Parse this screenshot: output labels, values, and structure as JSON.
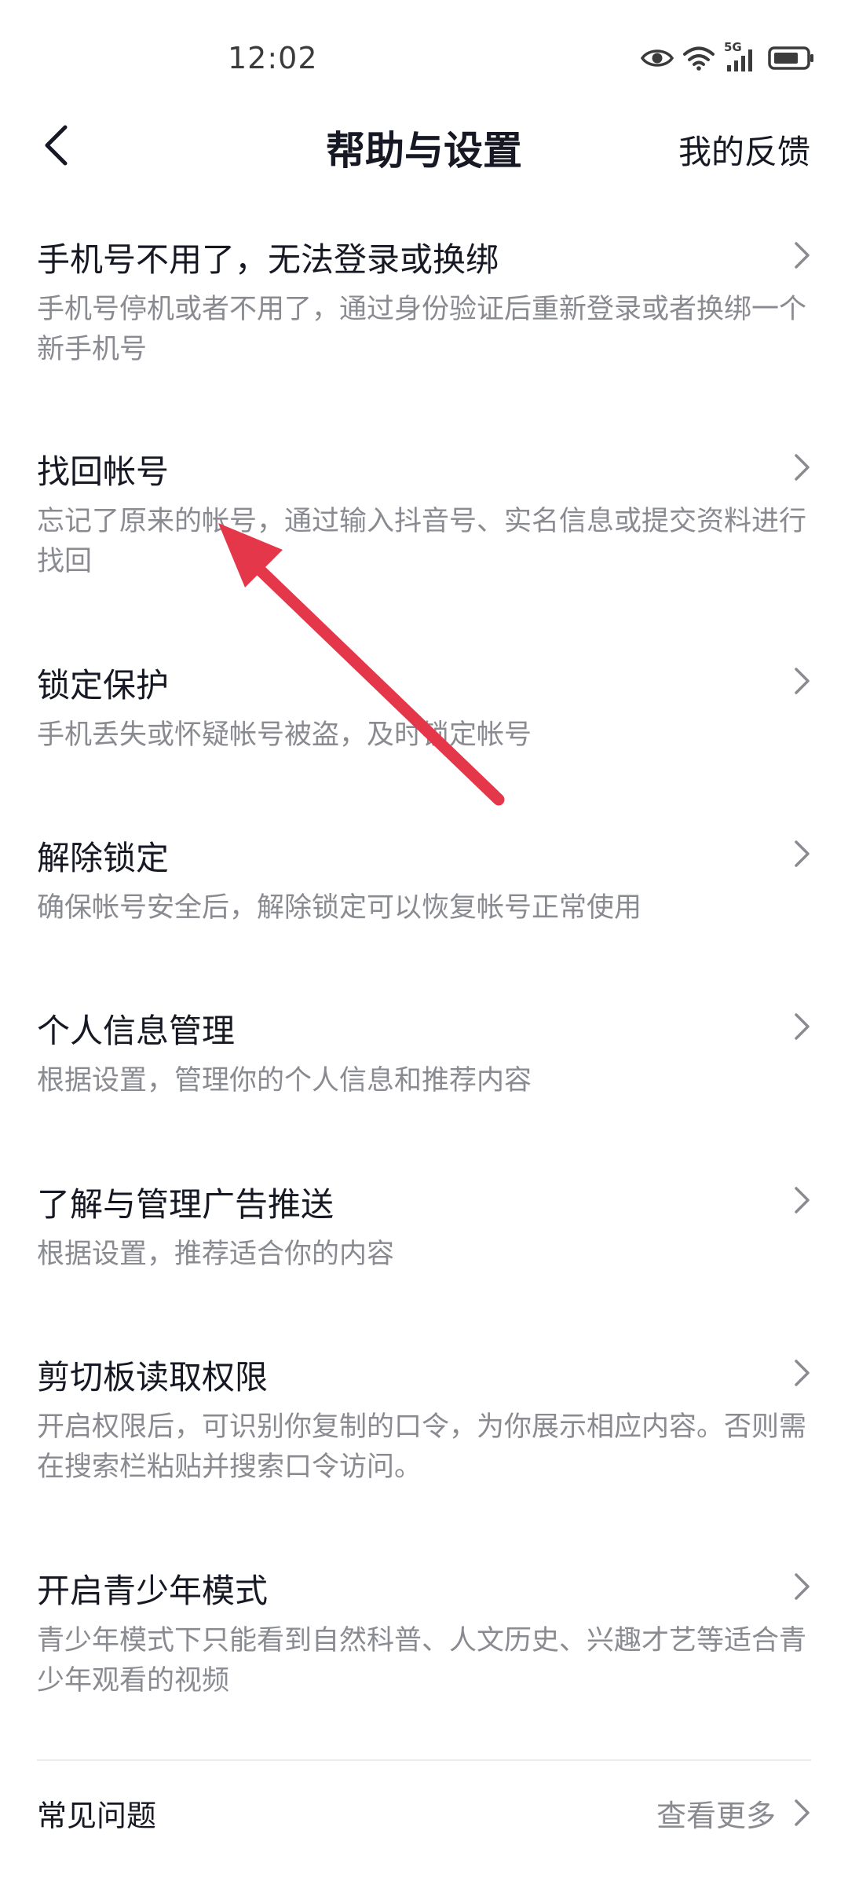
{
  "status_bar": {
    "time": "12:02",
    "network_label": "5G"
  },
  "header": {
    "title": "帮助与设置",
    "feedback_label": "我的反馈"
  },
  "items": [
    {
      "title": "手机号不用了，无法登录或换绑",
      "desc": "手机号停机或者不用了，通过身份验证后重新登录或者换绑一个新手机号"
    },
    {
      "title": "找回帐号",
      "desc": "忘记了原来的帐号，通过输入抖音号、实名信息或提交资料进行找回"
    },
    {
      "title": "锁定保护",
      "desc": "手机丢失或怀疑帐号被盗，及时锁定帐号"
    },
    {
      "title": "解除锁定",
      "desc": "确保帐号安全后，解除锁定可以恢复帐号正常使用"
    },
    {
      "title": "个人信息管理",
      "desc": "根据设置，管理你的个人信息和推荐内容"
    },
    {
      "title": "了解与管理广告推送",
      "desc": "根据设置，推荐适合你的内容"
    },
    {
      "title": "剪切板读取权限",
      "desc": "开启权限后，可识别你复制的口令，为你展示相应内容。否则需在搜索栏粘贴并搜索口令访问。"
    },
    {
      "title": "开启青少年模式",
      "desc": "青少年模式下只能看到自然科普、人文历史、兴趣才艺等适合青少年观看的视频"
    }
  ],
  "faq": {
    "label": "常见问题",
    "more_label": "查看更多"
  },
  "colors": {
    "title_text": "#161823",
    "desc_text": "#8a8b91",
    "annotation_arrow": "#e5374a"
  }
}
